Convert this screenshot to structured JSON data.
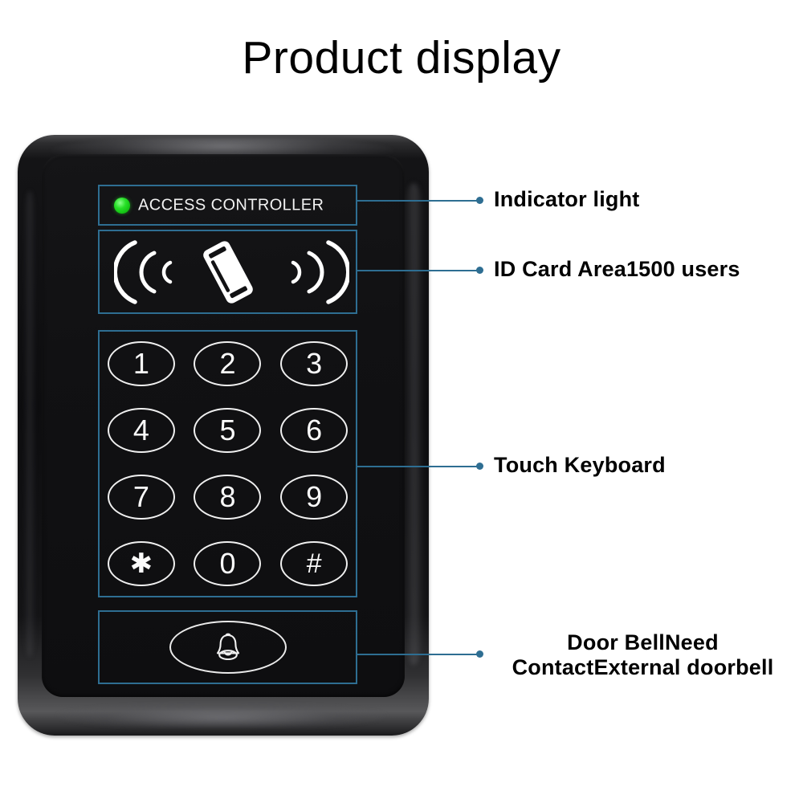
{
  "page": {
    "title": "Product display",
    "background_color": "#ffffff"
  },
  "colors": {
    "annotation_blue": "#2e6e92",
    "led_green": "#27e027",
    "device_black": "#111113",
    "key_outline": "#f0f0f0",
    "text_black": "#000000"
  },
  "device": {
    "indicator_panel": {
      "label": "ACCESS CONTROLLER",
      "led_name": "indicator-led",
      "led_color": "#27e027"
    },
    "id_card_panel": {
      "icon": "rfid-card-icon",
      "wave_left": "signal-waves-left-icon",
      "wave_right": "signal-waves-right-icon",
      "wave_count": 3
    },
    "keypad": {
      "keys": [
        "1",
        "2",
        "3",
        "4",
        "5",
        "6",
        "7",
        "8",
        "9",
        "✱",
        "0",
        "#"
      ],
      "rows": 4,
      "columns": 3
    },
    "doorbell_panel": {
      "icon": "bell-icon"
    }
  },
  "callouts": [
    {
      "id": "indicator-light",
      "label": "Indicator light",
      "target": "indicator-panel"
    },
    {
      "id": "id-card-area",
      "label": "ID Card Area1500 users",
      "target": "id-card-panel"
    },
    {
      "id": "touch-keyboard",
      "label": "Touch Keyboard",
      "target": "keypad-panel"
    },
    {
      "id": "door-bell",
      "label_line1": "Door BellNeed",
      "label_line2": "ContactExternal doorbell",
      "target": "doorbell-panel"
    }
  ]
}
